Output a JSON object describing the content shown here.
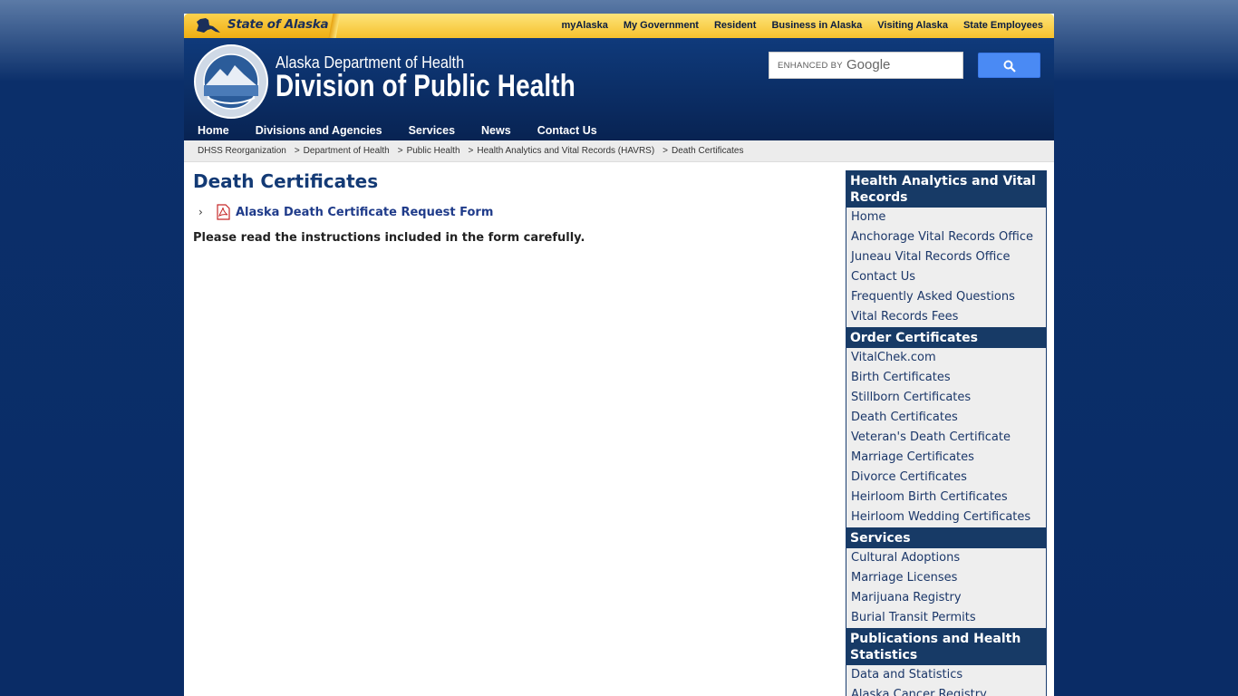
{
  "state_bar": {
    "brand": "State of Alaska",
    "links": [
      "myAlaska",
      "My Government",
      "Resident",
      "Business in Alaska",
      "Visiting Alaska",
      "State Employees"
    ]
  },
  "header": {
    "dept": "Alaska Department of Health",
    "division": "Division of Public Health",
    "search_placeholder": "ENHANCED BY",
    "search_brand": "Google"
  },
  "main_nav": [
    "Home",
    "Divisions and Agencies",
    "Services",
    "News",
    "Contact Us"
  ],
  "breadcrumb": [
    "DHSS Reorganization",
    "Department of Health",
    "Public Health",
    "Health Analytics and Vital Records (HAVRS)",
    "Death Certificates"
  ],
  "content": {
    "title": "Death Certificates",
    "doc_link": "Alaska Death Certificate Request Form",
    "instructions": "Please read the instructions included in the form carefully."
  },
  "sidebar": [
    {
      "heading": "Health Analytics and Vital Records",
      "items": [
        "Home",
        "Anchorage Vital Records Office",
        "Juneau Vital Records Office",
        "Contact Us",
        "Frequently Asked Questions",
        "Vital Records Fees"
      ]
    },
    {
      "heading": "Order Certificates",
      "items": [
        "VitalChek.com",
        "Birth Certificates",
        "Stillborn Certificates",
        "Death Certificates",
        "Veteran's Death Certificate",
        "Marriage Certificates",
        "Divorce Certificates",
        "Heirloom Birth Certificates",
        "Heirloom Wedding Certificates"
      ]
    },
    {
      "heading": "Services",
      "items": [
        "Cultural Adoptions",
        "Marriage Licenses",
        "Marijuana Registry",
        "Burial Transit Permits"
      ]
    },
    {
      "heading": "Publications and Health Statistics",
      "items": [
        "Data and Statistics",
        "Alaska Cancer Registry"
      ]
    }
  ],
  "colors": {
    "header_blue": "#0a2a5f",
    "gold": "#f6c12d",
    "sidebar_head": "#173a66",
    "title_blue": "#133a75"
  }
}
